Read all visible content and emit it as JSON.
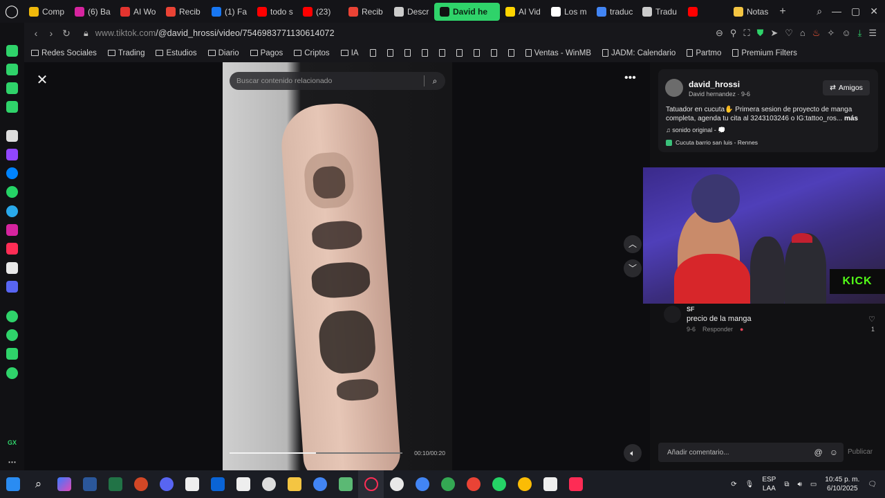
{
  "tabs": [
    {
      "label": "Comp",
      "color": "#f0b90b"
    },
    {
      "label": "(6) Ba",
      "color": "#d6249f"
    },
    {
      "label": "AI Wo",
      "color": "#e3342f"
    },
    {
      "label": "Recib",
      "color": "#ea4335"
    },
    {
      "label": "(1) Fa",
      "color": "#1877f2"
    },
    {
      "label": "todo s",
      "color": "#ff0000"
    },
    {
      "label": "(23)",
      "color": "#ff0000"
    },
    {
      "label": "Recib",
      "color": "#ea4335"
    },
    {
      "label": "Descr",
      "color": "#cccccc"
    },
    {
      "label": "David he",
      "color": "#111111",
      "active": true
    },
    {
      "label": "AI Vid",
      "color": "#ffd400"
    },
    {
      "label": "Los m",
      "color": "#ffffff"
    },
    {
      "label": "traduc",
      "color": "#4285f4"
    },
    {
      "label": "Tradu",
      "color": "#cccccc"
    },
    {
      "label": "",
      "color": "#ff0000"
    },
    {
      "label": "Notas",
      "color": "#f4c542"
    }
  ],
  "address": {
    "domain": "www.tiktok.com",
    "path": "/@david_hrossi/video/7546983771130614072"
  },
  "bookmarks": [
    {
      "label": "Redes Sociales",
      "type": "folder"
    },
    {
      "label": "Trading",
      "type": "folder"
    },
    {
      "label": "Estudios",
      "type": "folder"
    },
    {
      "label": "Diario",
      "type": "folder"
    },
    {
      "label": "Pagos",
      "type": "folder"
    },
    {
      "label": "Criptos",
      "type": "folder"
    },
    {
      "label": "IA",
      "type": "folder"
    },
    {
      "label": "",
      "type": "page"
    },
    {
      "label": "",
      "type": "page"
    },
    {
      "label": "",
      "type": "page"
    },
    {
      "label": "",
      "type": "page"
    },
    {
      "label": "",
      "type": "page"
    },
    {
      "label": "",
      "type": "page"
    },
    {
      "label": "",
      "type": "page"
    },
    {
      "label": "",
      "type": "page"
    },
    {
      "label": "",
      "type": "page"
    },
    {
      "label": "Ventas - WinMB",
      "type": "page"
    },
    {
      "label": "JADM: Calendario",
      "type": "page"
    },
    {
      "label": "Partmo",
      "type": "page"
    },
    {
      "label": "Premium Filters",
      "type": "page"
    }
  ],
  "viewer": {
    "search_placeholder": "Buscar contenido relacionado",
    "timecode": "00:10/00:20",
    "progress": 0.5
  },
  "post": {
    "username": "david_hrossi",
    "subline": "David hernandez · 9-6",
    "friends_label": "Amigos",
    "description": "Tatuador en cucuta✋ Primera sesion de proyecto de manga completa, agenda tu cita al 3243103246 o IG:tattoo_ros...",
    "more_label": "más",
    "sound": "♫  sonido original - 💭",
    "location": "Cucuta barrio san luis - Rennes"
  },
  "stream": {
    "badge": "KICK"
  },
  "comment": {
    "user": "SF",
    "text": "precio de la manga",
    "date": "9-6",
    "reply_label": "Responder",
    "likes": "1"
  },
  "comment_box": {
    "placeholder": "Añadir comentario...",
    "post_label": "Publicar"
  },
  "tray": {
    "lang_top": "ESP",
    "lang_bottom": "LAA",
    "time": "10:45 p. m.",
    "date": "6/10/2025"
  }
}
